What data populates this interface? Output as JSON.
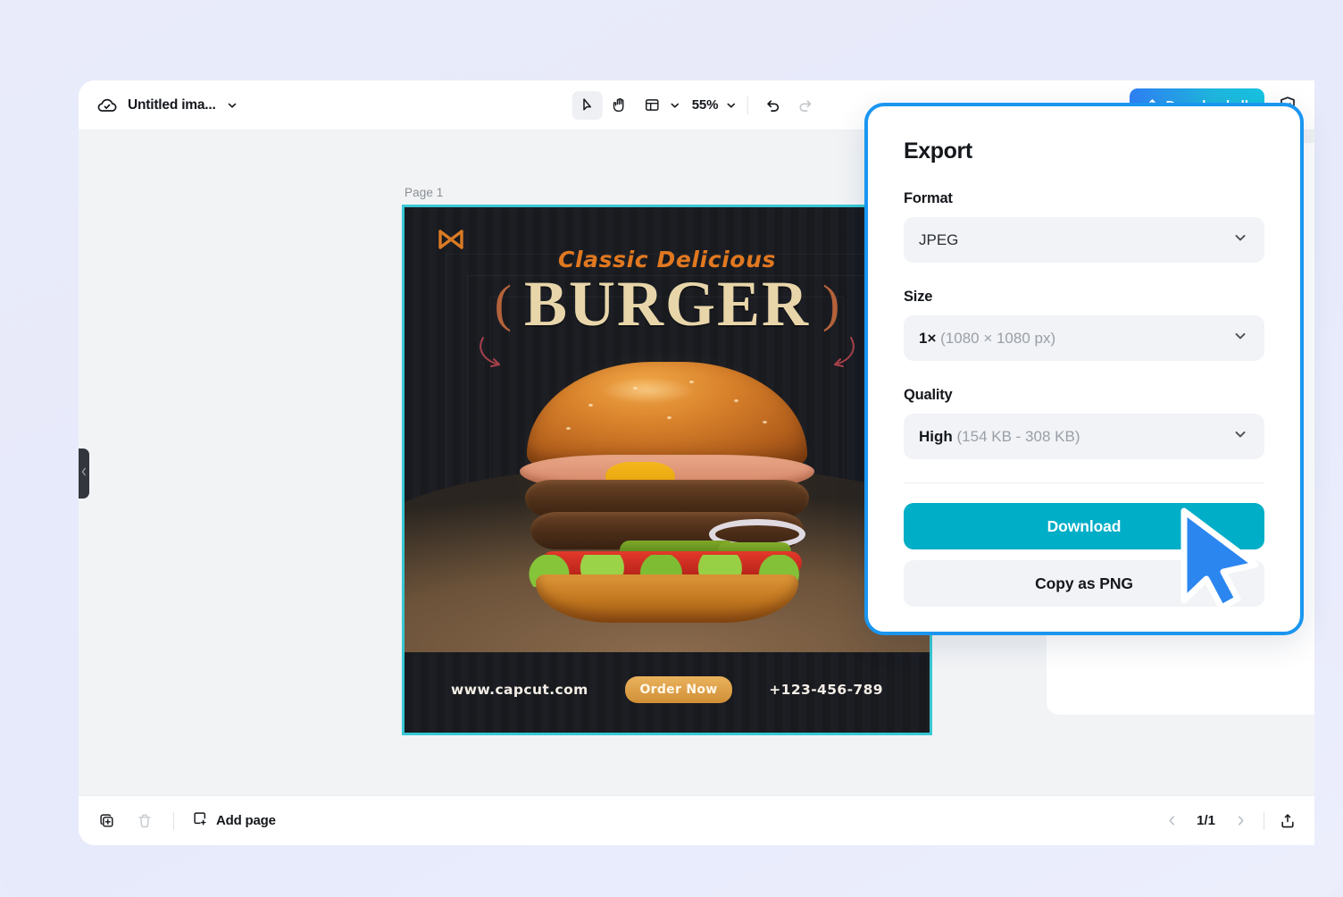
{
  "window": {
    "title": "Untitled ima...",
    "cloud_icon": "cloud-check-icon",
    "title_chevron": "chevron-down-icon"
  },
  "toolbar": {
    "tools": [
      {
        "name": "select-tool",
        "icon": "cursor-arrow-icon",
        "active": true
      },
      {
        "name": "hand-tool",
        "icon": "hand-icon",
        "active": false
      },
      {
        "name": "layout-tool",
        "icon": "layout-grid-icon",
        "active": false
      }
    ],
    "zoom_level": "55%",
    "zoom_chevron": "chevron-down-icon",
    "undo_icon": "undo-arrow-icon",
    "redo_icon": "redo-arrow-icon",
    "download_all_label": "Download all",
    "download_all_icon": "upload-icon",
    "shield_icon": "shield-check-icon"
  },
  "canvas": {
    "page_label": "Page 1"
  },
  "poster": {
    "logo": "capcut-logo-icon",
    "subtitle": "Classic Delicious",
    "title": "BURGER",
    "paren_left": "(",
    "paren_right": ")",
    "website": "www.capcut.com",
    "order_button": "Order Now",
    "phone": "+123-456-789",
    "colors": {
      "background": "#17181c",
      "accent_orange": "#e07820",
      "title_cream": "#e8d6aa",
      "selection_border": "#37c7d4",
      "order_button": "#d08f36"
    }
  },
  "export_popup": {
    "title": "Export",
    "format": {
      "label": "Format",
      "value": "JPEG",
      "chevron": "chevron-down-icon"
    },
    "size": {
      "label": "Size",
      "value_main": "1×",
      "value_detail": "(1080 × 1080 px)",
      "chevron": "chevron-down-icon"
    },
    "quality": {
      "label": "Quality",
      "value_main": "High",
      "value_detail": "(154 KB - 308 KB)",
      "chevron": "chevron-down-icon"
    },
    "download_label": "Download",
    "copy_png_label": "Copy as PNG",
    "colors": {
      "highlight_border": "#1a96f0",
      "download_button": "#00aec7"
    }
  },
  "bottombar": {
    "duplicate_icon": "duplicate-page-icon",
    "delete_icon": "trash-icon",
    "add_page_icon": "add-square-icon",
    "add_page_label": "Add page",
    "prev_icon": "chevron-left-icon",
    "page_indicator": "1/1",
    "next_icon": "chevron-right-icon",
    "export_icon": "export-box-icon"
  },
  "left_handle": {
    "icon": "chevron-left-icon"
  },
  "cursor": {
    "icon": "mouse-pointer-icon",
    "color": "#2b86f0"
  }
}
